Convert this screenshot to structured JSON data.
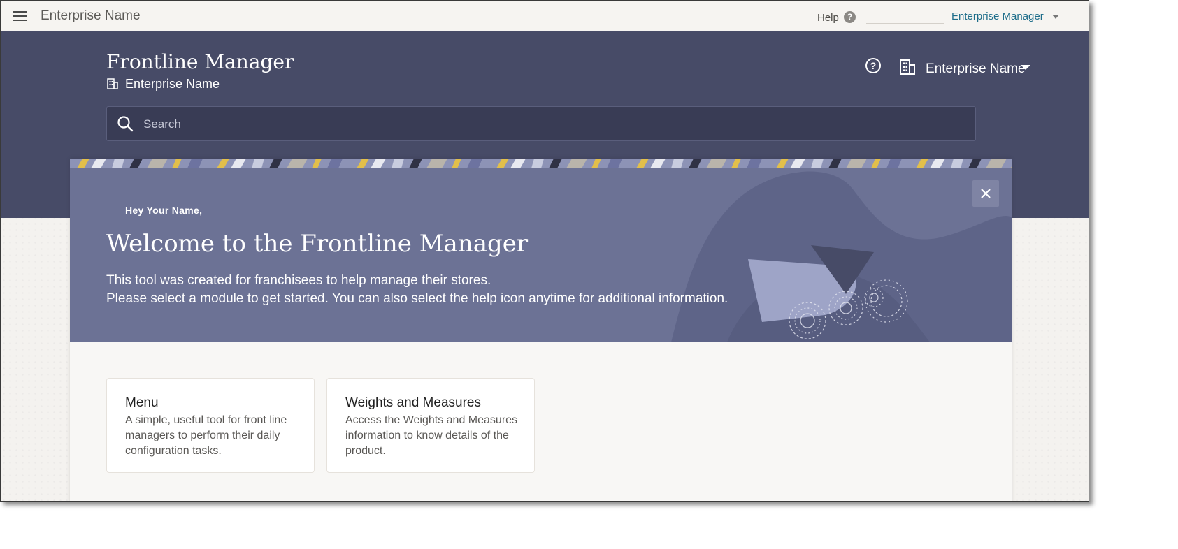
{
  "topbar": {
    "app_title": "Enterprise Name",
    "help_label": "Help",
    "help_icon": "question-circle-icon",
    "user_menu_label": "Enterprise Manager"
  },
  "header": {
    "title": "Frontline Manager",
    "enterprise_label": "Enterprise Name",
    "enterprise_selector_label": "Enterprise Name",
    "search_placeholder": "Search",
    "search_value": ""
  },
  "welcome": {
    "greeting": "Hey Your Name,",
    "title": "Welcome to the Frontline Manager",
    "line1": "This tool was created for franchisees to help manage their stores.",
    "line2": "Please select a module to get started. You can also select the help icon anytime for additional information.",
    "close_icon": "close-icon"
  },
  "modules": [
    {
      "title": "Menu",
      "description": "A simple, useful tool for front line managers to perform their daily configuration tasks."
    },
    {
      "title": "Weights and Measures",
      "description": "Access the Weights and Measures information to know details of the product."
    }
  ],
  "colors": {
    "header_bg": "#474b67",
    "hero_bg": "#6c7295",
    "link": "#1e6d8a",
    "search_bg": "#393c55"
  }
}
